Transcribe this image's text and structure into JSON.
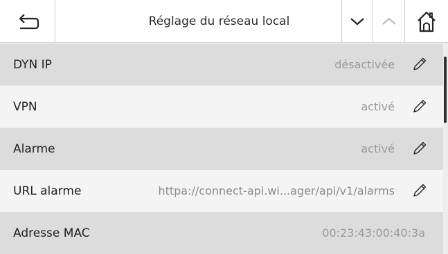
{
  "header": {
    "title": "Réglage du réseau local"
  },
  "rows": [
    {
      "label": "DYN IP",
      "value": "désactivée",
      "editable": true
    },
    {
      "label": "VPN",
      "value": "activé",
      "editable": true
    },
    {
      "label": "Alarme",
      "value": "activé",
      "editable": true
    },
    {
      "label": "URL alarme",
      "value": "httpa://connect-api.wi...ager/api/v1/alarms",
      "editable": true
    },
    {
      "label": "Adresse MAC",
      "value": "00:23:43:00:40:3a",
      "editable": false
    }
  ],
  "icons": {
    "back": "back-arrow-icon",
    "down": "chevron-down-icon",
    "up": "chevron-up-icon",
    "home": "home-icon",
    "edit": "pencil-icon"
  },
  "colors": {
    "row_grey": "#dcdcdc",
    "row_light": "#f4f4f4",
    "value_text": "#9a9a9a",
    "up_disabled": "#bdbdbd"
  }
}
